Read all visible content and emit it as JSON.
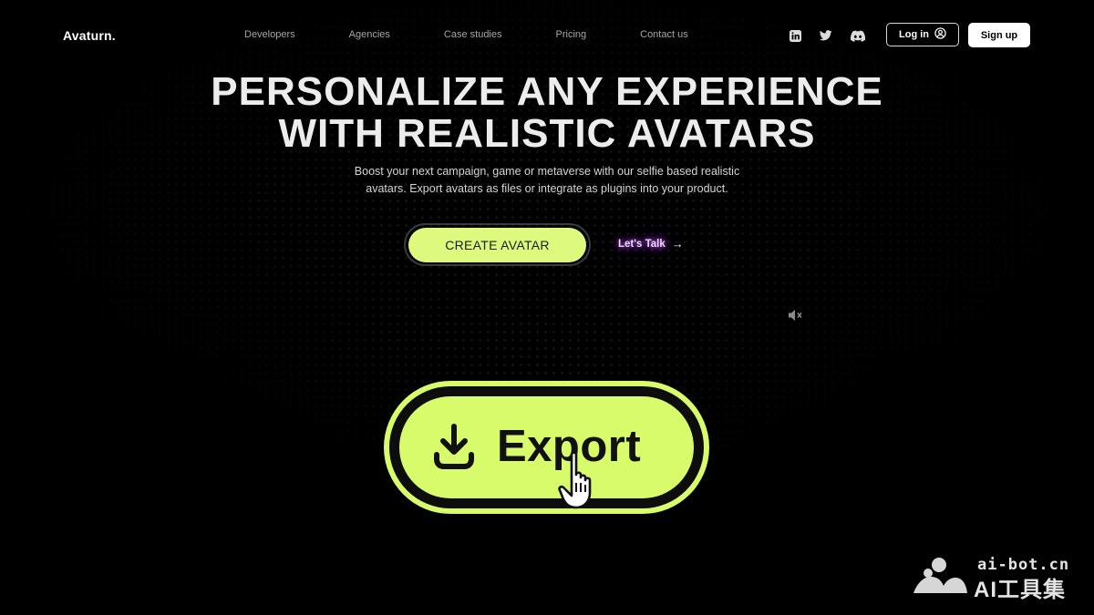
{
  "nav": {
    "logo": "Avaturn.",
    "links": [
      "Developers",
      "Agencies",
      "Case studies",
      "Pricing",
      "Contact us"
    ],
    "social_icons": [
      "linkedin-icon",
      "twitter-icon",
      "discord-icon"
    ],
    "login_label": "Log in",
    "signup_label": "Sign up"
  },
  "hero": {
    "headline_line1": "PERSONALIZE ANY EXPERIENCE",
    "headline_line2": "WITH REALISTIC AVATARS",
    "subtext_line1": "Boost your next campaign, game or metaverse with our selfie based realistic",
    "subtext_line2": "avatars. Export avatars as files or integrate as plugins into your product.",
    "cta_label": "CREATE AVATAR",
    "talk_label": "Let's Talk",
    "talk_arrow": "→"
  },
  "video": {
    "export_label": "Export",
    "mute_icon": "muted-speaker-icon"
  },
  "watermark": {
    "line1": "ai-bot.cn",
    "line2": "AI工具集"
  },
  "colors": {
    "accent": "#ddf97e",
    "background": "#000000",
    "talk_glow": "#c75bff"
  }
}
